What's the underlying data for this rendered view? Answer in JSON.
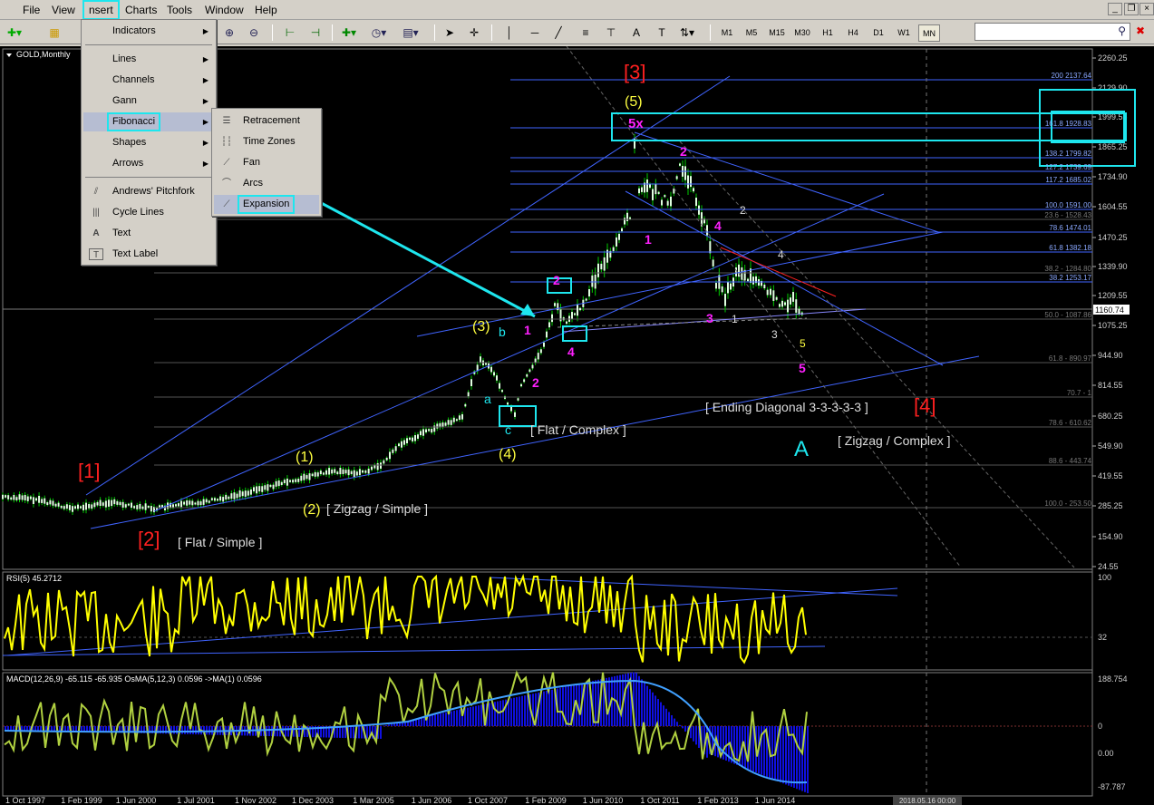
{
  "menubar": {
    "file": "File",
    "view": "View",
    "insert": "nsert",
    "charts": "Charts",
    "tools": "Tools",
    "window": "Window",
    "help": "Help"
  },
  "insert_menu": {
    "indicators": "Indicators",
    "lines": "Lines",
    "channels": "Channels",
    "gann": "Gann",
    "fibonacci": "Fibonacci",
    "shapes": "Shapes",
    "arrows": "Arrows",
    "pitchfork": "Andrews' Pitchfork",
    "cycle": "Cycle Lines",
    "text": "Text",
    "textlabel": "Text Label"
  },
  "fib_menu": {
    "retracement": "Retracement",
    "timezones": "Time Zones",
    "fan": "Fan",
    "arcs": "Arcs",
    "expansion": "Expansion"
  },
  "toolbar": {
    "timeframes": [
      "M1",
      "M5",
      "M15",
      "M30",
      "H1",
      "H4",
      "D1",
      "W1",
      "MN"
    ],
    "active": "MN",
    "t_a": "A",
    "t_t": "T"
  },
  "chart": {
    "title": "GOLD,Monthly",
    "prices": [
      "2260.25",
      "2129.90",
      "1999.55",
      "1865.25",
      "1734.90",
      "1604.55",
      "1470.25",
      "1339.90",
      "1209.55",
      "1160.74",
      "1075.25",
      "944.90",
      "814.55",
      "680.25",
      "549.90",
      "419.55",
      "285.25",
      "154.90",
      "24.55"
    ],
    "fib_labels": [
      "200 2137.64",
      "161.8 1928.83",
      "138.2 1799.82",
      "127.2 1739.69",
      "117.2 1685.02",
      "100.0 1591.00",
      "23.6 - 1528.43",
      "78.6 1474.01",
      "61.8 1382.18",
      "38.2 - 1284.80",
      "38.2 1253.17",
      "50.0 - 1087.86",
      "61.8 - 890.97",
      "70.7 - 1",
      "78.6 - 610.62",
      "88.6 - 443.74",
      "100.0 - 253.50"
    ],
    "waves": {
      "w1": "[1]",
      "w2": "[2]",
      "w3": "[3]",
      "w4": "[4]",
      "flat_simple": "[ Flat / Simple ]",
      "zz_simple": "[ Zigzag / Simple ]",
      "flat_complex": "[ Flat / Complex ]",
      "ending": "[ Ending Diagonal 3-3-3-3-3 ]",
      "zz_complex": "[ Zigzag / Complex ]",
      "p1": "(1)",
      "p2": "(2)",
      "p3": "(3)",
      "p4": "(4)",
      "p5": "(5)",
      "x5": "5x",
      "a": "a",
      "b": "b",
      "c": "c",
      "A": "A",
      "m1": "1",
      "m2": "2",
      "m3": "2",
      "m4": "4",
      "m1b": "1",
      "m2b": "2",
      "m3b": "3",
      "m4b": "4",
      "m5b": "5",
      "m3c": "3",
      "m4c": "4",
      "m5c": "5"
    }
  },
  "rsi": {
    "title": "RSI(5) 45.2712",
    "scale_top": "100",
    "scale_mid": "32"
  },
  "macd": {
    "title": "MACD(12,26,9) -65.115 -65.935  OsMA(5,12,3) 0.0596  ->MA(1) 0.0596",
    "scale": [
      "188.754",
      "0",
      "0.00",
      "-87.787"
    ]
  },
  "xaxis": {
    "labels": [
      "1 Oct 1997",
      "1 Feb 1999",
      "1 Jun 2000",
      "1 Jul 2001",
      "1 Nov 2002",
      "1 Dec 2003",
      "1 Mar 2005",
      "1 Jun 2006",
      "1 Oct 2007",
      "1 Feb 2009",
      "1 Jun 2010",
      "1 Oct 2011",
      "1 Feb 2013",
      "1 Jun 2014"
    ],
    "cursor_label": "2018.05.16 00:00"
  },
  "colors": {
    "cyan": "#1ee6ee",
    "fib_blue": "#4064ff",
    "candle": "#00cc00",
    "rsi": "#ffff00",
    "red": "#ff2020",
    "magenta": "#ff20ff",
    "yellow": "#ffff40"
  }
}
